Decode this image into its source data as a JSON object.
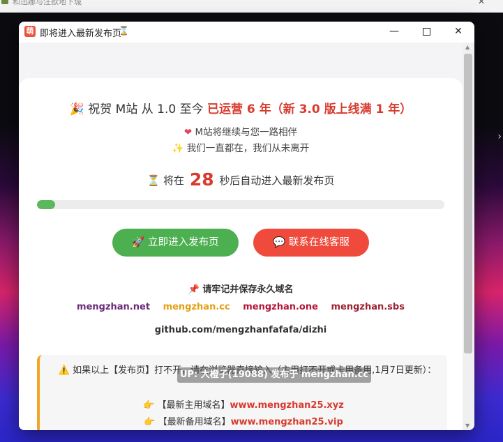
{
  "background": {
    "title": "和迅娜与注欲地下城",
    "close": "✕"
  },
  "window": {
    "icon_text": "萌",
    "title": "即将进入最新发布页",
    "title_icon": "hourglass-icon",
    "controls": {
      "minimize": "—",
      "close": "✕"
    }
  },
  "main": {
    "headline_icon": "🎉",
    "headline_prefix": "祝贺 M站 从 1.0 至今",
    "headline_highlight": "已运营 6 年（新 3.0 版上线满 1 年）",
    "sub1_icon": "❤",
    "sub1": "M站将继续与您一路相伴",
    "sub2_icon": "✨",
    "sub2": "我们一直都在，我们从未离开",
    "countdown_icon": "⏳",
    "countdown_prefix": "将在",
    "countdown_seconds": "28",
    "countdown_suffix": "秒后自动进入最新发布页",
    "progress_percent": 4.5,
    "btn_enter": "🚀  立即进入发布页",
    "btn_support": "💬  联系在线客服",
    "pin_icon": "📌",
    "pin_text": "请牢记并保存永久域名",
    "domains": [
      "mengzhan.net",
      "mengzhan.cc",
      "mengzhan.one",
      "mengzhan.sbs"
    ],
    "github": "github.com/mengzhanfafafa/dizhi"
  },
  "notice": {
    "warn_icon": "⚠️",
    "text": "如果以上【发布页】打不开，请在浏览器直接输入（主用打不开或卡用备用,1月7日更新）：",
    "main_icon": "👉",
    "main_label": "【最新主用域名】",
    "main_url": "www.mengzhan25.xyz",
    "backup_icon": "👉",
    "backup_label": "【最新备用域名】",
    "backup_url": "www.mengzhan25.vip"
  },
  "overlay": {
    "caption": "UP: 大橙子(19088) 发布于 mengzhan.cc"
  },
  "colors": {
    "accent_red": "#d83b2e",
    "green": "#4caf50",
    "button_red": "#ef4a3c",
    "notice_border": "#f2a524"
  }
}
